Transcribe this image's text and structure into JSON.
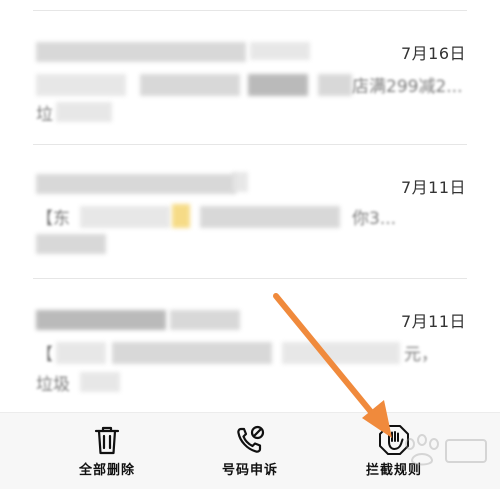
{
  "messages": [
    {
      "date": "7月16日",
      "preview_visible": "店满299减2...",
      "line3_visible": "垃"
    },
    {
      "date": "7月11日",
      "preview_visible": "【东",
      "preview_tail": "你3...",
      "line3_visible": ""
    },
    {
      "date": "7月11日",
      "preview_visible": "【",
      "preview_tail": "元，",
      "line3_visible": "垃圾"
    }
  ],
  "toolbar": {
    "delete_all_label": "全部删除",
    "number_appeal_label": "号码申诉",
    "block_rules_label": "拦截规则"
  },
  "colors": {
    "arrow": "#f08a3c",
    "toolbar_bg": "#f7f7f7"
  },
  "icons": {
    "delete_all": "trash-icon",
    "number_appeal": "phone-block-icon",
    "block_rules": "hand-stop-icon"
  }
}
